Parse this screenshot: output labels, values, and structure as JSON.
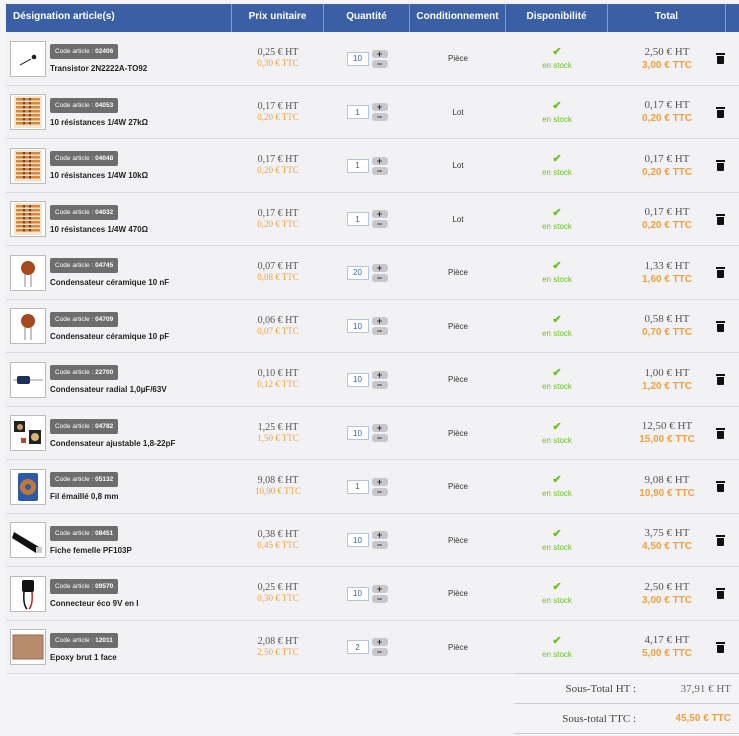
{
  "headers": {
    "designation": "Désignation article(s)",
    "unit_price": "Prix unitaire",
    "quantity": "Quantité",
    "packaging": "Conditionnement",
    "availability": "Disponibilité",
    "total": "Total"
  },
  "code_prefix": "Code article :",
  "items": [
    {
      "code": "02406",
      "name": "Transistor 2N2222A-TO92",
      "price_ht": "0,25 € HT",
      "price_ttc": "0,30 € TTC",
      "qty": "10",
      "pack": "Pièce",
      "avail": "en stock",
      "total_ht": "2,50 € HT",
      "total_ttc": "3,00 € TTC",
      "thumb": "transistor"
    },
    {
      "code": "04053",
      "name": "10 résistances 1/4W 27kΩ",
      "price_ht": "0,17 € HT",
      "price_ttc": "0,20 € TTC",
      "qty": "1",
      "pack": "Lot",
      "avail": "en stock",
      "total_ht": "0,17 € HT",
      "total_ttc": "0,20 € TTC",
      "thumb": "resistors"
    },
    {
      "code": "04048",
      "name": "10 résistances 1/4W 10kΩ",
      "price_ht": "0,17 € HT",
      "price_ttc": "0,20 € TTC",
      "qty": "1",
      "pack": "Lot",
      "avail": "en stock",
      "total_ht": "0,17 € HT",
      "total_ttc": "0,20 € TTC",
      "thumb": "resistors"
    },
    {
      "code": "04032",
      "name": "10 résistances 1/4W 470Ω",
      "price_ht": "0,17 € HT",
      "price_ttc": "0,20 € TTC",
      "qty": "1",
      "pack": "Lot",
      "avail": "en stock",
      "total_ht": "0,17 € HT",
      "total_ttc": "0,20 € TTC",
      "thumb": "resistors"
    },
    {
      "code": "04745",
      "name": "Condensateur céramique 10 nF",
      "price_ht": "0,07 € HT",
      "price_ttc": "0,08 € TTC",
      "qty": "20",
      "pack": "Pièce",
      "avail": "en stock",
      "total_ht": "1,33 € HT",
      "total_ttc": "1,60 € TTC",
      "thumb": "ceramic"
    },
    {
      "code": "04709",
      "name": "Condensateur céramique 10 pF",
      "price_ht": "0,06 € HT",
      "price_ttc": "0,07 € TTC",
      "qty": "10",
      "pack": "Pièce",
      "avail": "en stock",
      "total_ht": "0,58 € HT",
      "total_ttc": "0,70 € TTC",
      "thumb": "ceramic"
    },
    {
      "code": "22700",
      "name": "Condensateur radial 1,0µF/63V",
      "price_ht": "0,10 € HT",
      "price_ttc": "0,12 € TTC",
      "qty": "10",
      "pack": "Pièce",
      "avail": "en stock",
      "total_ht": "1,00 € HT",
      "total_ttc": "1,20 € TTC",
      "thumb": "radial"
    },
    {
      "code": "04782",
      "name": "Condensateur ajustable 1,8-22pF",
      "price_ht": "1,25 € HT",
      "price_ttc": "1,50 € TTC",
      "qty": "10",
      "pack": "Pièce",
      "avail": "en stock",
      "total_ht": "12,50 € HT",
      "total_ttc": "15,00 € TTC",
      "thumb": "trimmer"
    },
    {
      "code": "05132",
      "name": "Fil émaillé 0,8 mm",
      "price_ht": "9,08 € HT",
      "price_ttc": "10,90 € TTC",
      "qty": "1",
      "pack": "Pièce",
      "avail": "en stock",
      "total_ht": "9,08 € HT",
      "total_ttc": "10,90 € TTC",
      "thumb": "wire"
    },
    {
      "code": "08451",
      "name": "Fiche femelle PF103P",
      "price_ht": "0,38 € HT",
      "price_ttc": "0,45 € TTC",
      "qty": "10",
      "pack": "Pièce",
      "avail": "en stock",
      "total_ht": "3,75 € HT",
      "total_ttc": "4,50 € TTC",
      "thumb": "jack"
    },
    {
      "code": "09570",
      "name": "Connecteur éco 9V en I",
      "price_ht": "0,25 € HT",
      "price_ttc": "0,30 € TTC",
      "qty": "10",
      "pack": "Pièce",
      "avail": "en stock",
      "total_ht": "2,50 € HT",
      "total_ttc": "3,00 € TTC",
      "thumb": "battery"
    },
    {
      "code": "12011",
      "name": "Epoxy brut 1 face",
      "price_ht": "2,08 € HT",
      "price_ttc": "2,50 € TTC",
      "qty": "2",
      "pack": "Pièce",
      "avail": "en stock",
      "total_ht": "4,17 € HT",
      "total_ttc": "5,00 € TTC",
      "thumb": "epoxy"
    }
  ],
  "totals": {
    "subtotal_ht_label": "Sous-Total HT :",
    "subtotal_ht_value": "37,91 € HT",
    "subtotal_ttc_label": "Sous-total TTC :",
    "subtotal_ttc_value": "45,50 € TTC"
  },
  "colors": {
    "header": "#3a5fa4",
    "accent_orange": "#f0a040",
    "stock_green": "#6cbf2a"
  },
  "icons": {
    "availability": "check-icon",
    "delete": "trash-icon",
    "qty_up": "plus-icon",
    "qty_down": "minus-icon"
  }
}
